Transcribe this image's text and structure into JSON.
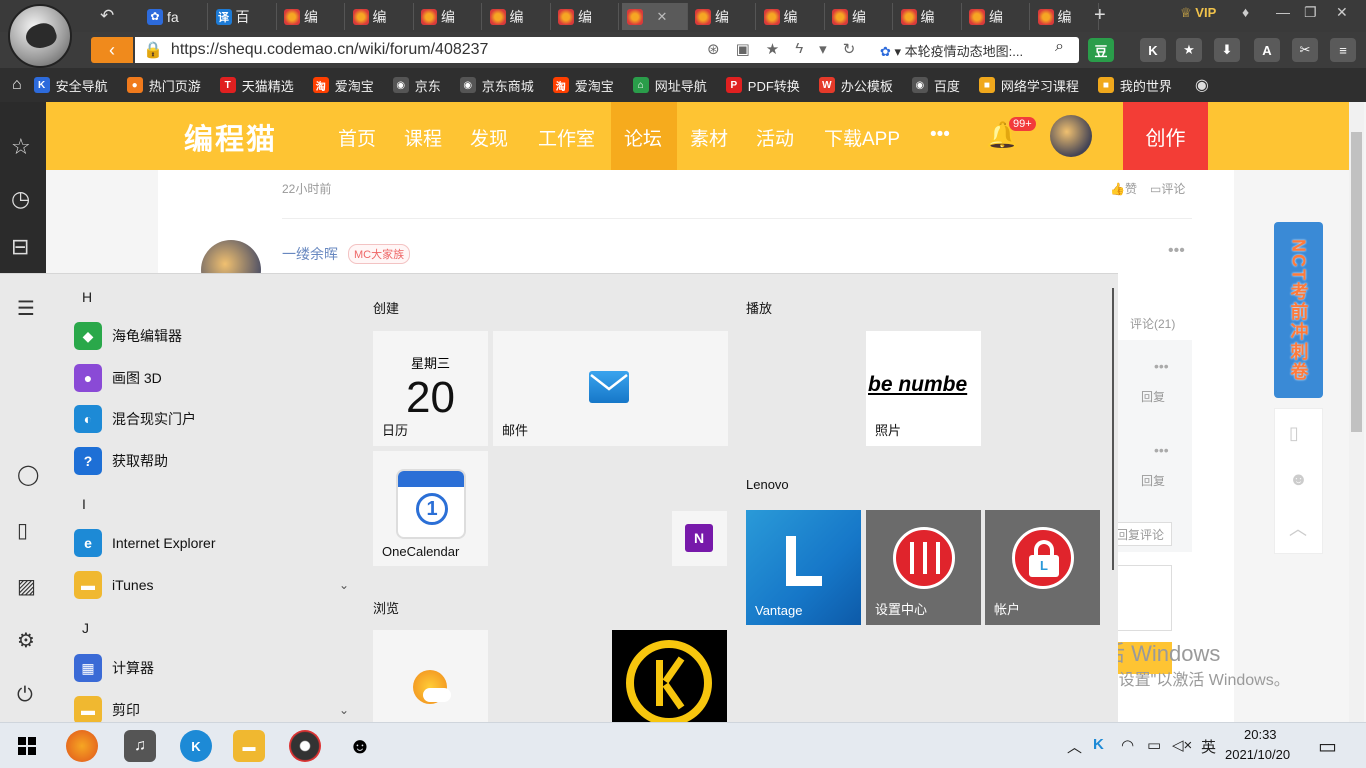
{
  "browser": {
    "tabs": [
      {
        "label": "fa",
        "icon": "baidu"
      },
      {
        "label": "百",
        "icon": "fanyi"
      },
      {
        "label": "编",
        "icon": "paw"
      },
      {
        "label": "编",
        "icon": "paw"
      },
      {
        "label": "编",
        "icon": "paw"
      },
      {
        "label": "编",
        "icon": "paw"
      },
      {
        "label": "编",
        "icon": "paw"
      },
      {
        "label": "",
        "icon": "paw",
        "active": true
      },
      {
        "label": "编",
        "icon": "paw"
      },
      {
        "label": "编",
        "icon": "paw"
      },
      {
        "label": "编",
        "icon": "paw"
      },
      {
        "label": "编",
        "icon": "paw"
      },
      {
        "label": "编",
        "icon": "paw"
      },
      {
        "label": "编",
        "icon": "paw"
      }
    ],
    "new_tab": "+",
    "vip": "VIP",
    "url": "https://shequ.codemao.cn/wiki/forum/408237",
    "search_hint": "本轮疫情动态地图:...",
    "extension_dou": "豆",
    "bookmarks": [
      {
        "label": "安全导航",
        "color": "#2d6bdc",
        "glyph": "K"
      },
      {
        "label": "热门页游",
        "color": "#f07a1c",
        "glyph": "●"
      },
      {
        "label": "天猫精选",
        "color": "#e02020",
        "glyph": "T"
      },
      {
        "label": "爱淘宝",
        "color": "#ff3f00",
        "glyph": "淘"
      },
      {
        "label": "京东",
        "color": "#555",
        "glyph": "◉"
      },
      {
        "label": "京东商城",
        "color": "#555",
        "glyph": "◉"
      },
      {
        "label": "爱淘宝",
        "color": "#ff3f00",
        "glyph": "淘"
      },
      {
        "label": "网址导航",
        "color": "#2a9d4a",
        "glyph": "⌂"
      },
      {
        "label": "PDF转换",
        "color": "#e02020",
        "glyph": "P"
      },
      {
        "label": "办公模板",
        "color": "#e53a2a",
        "glyph": "W"
      },
      {
        "label": "百度",
        "color": "#555",
        "glyph": "◉"
      },
      {
        "label": "网络学习课程",
        "color": "#f0a81c",
        "glyph": "■"
      },
      {
        "label": "我的世界",
        "color": "#f0a81c",
        "glyph": "■"
      }
    ]
  },
  "site": {
    "logo": "编程猫",
    "nav": [
      "首页",
      "课程",
      "发现",
      "工作室",
      "论坛",
      "素材",
      "活动",
      "下载APP",
      "•••"
    ],
    "bell_badge": "99+",
    "create": "创作",
    "post": {
      "time": "22小时前",
      "like": "赞",
      "comment": "评论",
      "author": "一缕余晖",
      "badge": "MC大家族",
      "more": "•••",
      "comment_count": "评论(21)",
      "reply": "回复",
      "reply_comment": "回复评论"
    },
    "banner": "NCT考前冲刺卷"
  },
  "start_menu": {
    "letters": [
      "H",
      "I",
      "J"
    ],
    "apps": [
      {
        "label": "海龟编辑器",
        "color": "#2aa84a",
        "glyph": "◆"
      },
      {
        "label": "画图 3D",
        "color": "#8a4ad6",
        "glyph": "●"
      },
      {
        "label": "混合现实门户",
        "color": "#1d8ad6",
        "glyph": "◐"
      },
      {
        "label": "获取帮助",
        "color": "#1d6fd6",
        "glyph": "?"
      },
      {
        "label": "Internet Explorer",
        "color": "#1d8ad6",
        "glyph": "e"
      },
      {
        "label": "iTunes",
        "color": "#f0b830",
        "glyph": "▬",
        "expand": true
      },
      {
        "label": "计算器",
        "color": "#3a6ad6",
        "glyph": "▦"
      },
      {
        "label": "剪印",
        "color": "#f0b830",
        "glyph": "▬",
        "expand": true
      }
    ],
    "groups": {
      "create": "创建",
      "play": "播放",
      "lenovo": "Lenovo",
      "browse": "浏览"
    },
    "tiles": {
      "calendar_weekday": "星期三",
      "calendar_day": "20",
      "calendar_label": "日历",
      "mail": "邮件",
      "photos_text": "be numbe",
      "photos": "照片",
      "onecalendar": "OneCalendar",
      "vantage": "Vantage",
      "settings_center": "设置中心",
      "account": "帐户"
    }
  },
  "watermark": {
    "title": "激活 Windows",
    "subtitle": "转到\"设置\"以激活 Windows。"
  },
  "taskbar": {
    "ime": "英",
    "time": "20:33",
    "date": "2021/10/20"
  }
}
